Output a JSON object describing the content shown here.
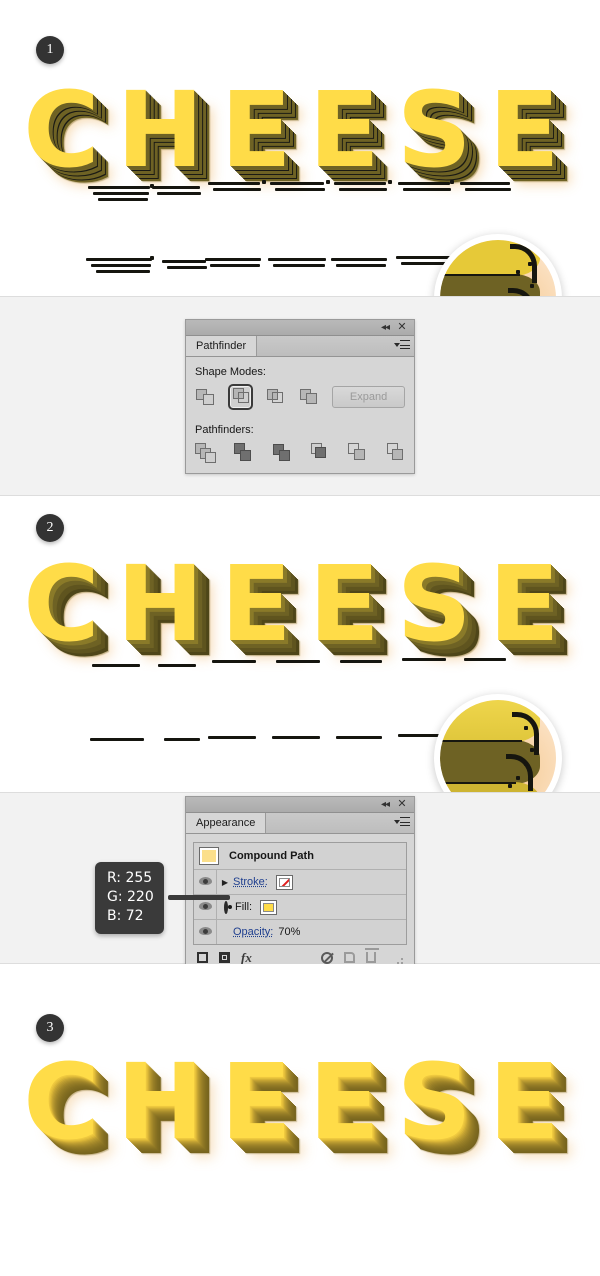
{
  "document": {
    "title": "Illustrator cheese text tutorial steps"
  },
  "artwork": {
    "word": "CHEESE",
    "fill_color": "#FFDC48",
    "extrude_color": "#6e6224",
    "glow_color": "#eba950"
  },
  "steps": [
    {
      "number": "1",
      "artwork_state": "raw stacked extrusion with visible anchor points"
    },
    {
      "number": "2",
      "artwork_state": "merged extrusion after Unite shape mode"
    },
    {
      "number": "3",
      "artwork_state": "final smooth cheese text"
    }
  ],
  "pathfinder_panel": {
    "titlebar": {
      "collapse_icon": "collapse-icon",
      "close_icon": "close-icon"
    },
    "tab_label": "Pathfinder",
    "menu_icon": "panel-menu-icon",
    "shape_modes_label": "Shape Modes:",
    "shape_modes": [
      {
        "name": "unite",
        "selected": false
      },
      {
        "name": "minus-front",
        "selected": true
      },
      {
        "name": "intersect",
        "selected": false
      },
      {
        "name": "exclude",
        "selected": false
      }
    ],
    "expand_label": "Expand",
    "expand_enabled": false,
    "pathfinders_label": "Pathfinders:",
    "pathfinders": [
      {
        "name": "divide"
      },
      {
        "name": "trim"
      },
      {
        "name": "merge"
      },
      {
        "name": "crop"
      },
      {
        "name": "outline"
      },
      {
        "name": "minus-back"
      }
    ]
  },
  "appearance_panel": {
    "titlebar": {
      "collapse_icon": "collapse-icon",
      "close_icon": "close-icon"
    },
    "tab_label": "Appearance",
    "menu_icon": "panel-menu-icon",
    "object_row": {
      "label": "Compound Path",
      "thumbnail_color": "#FBDF8B"
    },
    "rows": [
      {
        "label": "Stroke:",
        "swatch": "none",
        "has_disclosure": true,
        "visible": true
      },
      {
        "label": "Fill:",
        "swatch": "#FFDC48",
        "has_disclosure": false,
        "visible": true,
        "targeted": true
      },
      {
        "label": "Opacity:",
        "value": "70%",
        "visible": true
      }
    ],
    "footer_icons": [
      {
        "name": "add-new-stroke-icon"
      },
      {
        "name": "add-new-fill-icon"
      },
      {
        "name": "add-new-effect-icon",
        "label": "fx"
      },
      {
        "name": "clear-appearance-icon"
      },
      {
        "name": "duplicate-item-icon"
      },
      {
        "name": "delete-item-icon"
      },
      {
        "name": "resize-grip-icon"
      }
    ]
  },
  "rgb_tooltip": {
    "r_label": "R:",
    "r_value": "255",
    "g_label": "G:",
    "g_value": "220",
    "b_label": "B:",
    "b_value": "72",
    "lines": [
      "R: 255",
      "G: 220",
      "B: 72"
    ]
  },
  "magnifiers": [
    {
      "name": "loupe-step-1",
      "content": "zoomed stacked extrusion edges with anchor points"
    },
    {
      "name": "loupe-step-2",
      "content": "zoomed merged extrusion edge with anchor points"
    }
  ]
}
